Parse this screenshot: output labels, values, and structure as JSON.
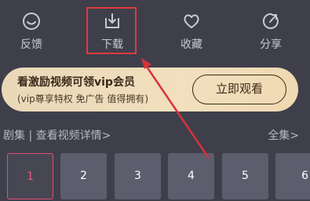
{
  "actions": [
    {
      "label": "反馈",
      "icon": "smile-face-icon"
    },
    {
      "label": "下载",
      "icon": "download-icon"
    },
    {
      "label": "收藏",
      "icon": "heart-icon"
    },
    {
      "label": "分享",
      "icon": "share-icon"
    }
  ],
  "banner": {
    "title": "看激励视频可领vip会员",
    "subtitle": "(vip尊享特权 免广告 值得拥有)",
    "cta": "立即观看"
  },
  "episodes_header": {
    "left": "剧集 | 查看视频详情>",
    "all": "全集>"
  },
  "episodes": [
    "1",
    "2",
    "3",
    "4",
    "5",
    "6"
  ],
  "colors": {
    "background": "#3f3f4b",
    "highlight": "#e03a3e",
    "active_episode": "#e85b7f",
    "banner": "#f1dfbe"
  }
}
